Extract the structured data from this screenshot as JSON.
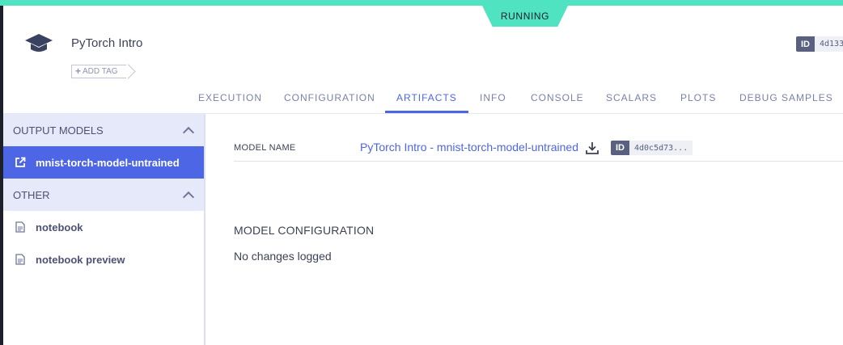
{
  "status": {
    "label": "RUNNING",
    "color": "#50e3c2"
  },
  "task": {
    "icon": "graduation-cap-icon",
    "title": "PyTorch Intro",
    "add_tag": "ADD TAG",
    "id_label": "ID",
    "id_value": "4d133"
  },
  "tabs": [
    {
      "label": "EXECUTION"
    },
    {
      "label": "CONFIGURATION"
    },
    {
      "label": "ARTIFACTS",
      "active": true
    },
    {
      "label": "INFO"
    },
    {
      "label": "CONSOLE"
    },
    {
      "label": "SCALARS"
    },
    {
      "label": "PLOTS"
    },
    {
      "label": "DEBUG SAMPLES"
    }
  ],
  "sidebar": {
    "sections": [
      {
        "title": "OUTPUT MODELS",
        "items": [
          {
            "label": "mnist-torch-model-untrained",
            "icon": "external-link-icon",
            "active": true
          }
        ]
      },
      {
        "title": "OTHER",
        "items": [
          {
            "label": "notebook",
            "icon": "document-icon"
          },
          {
            "label": "notebook preview",
            "icon": "document-icon"
          }
        ]
      }
    ]
  },
  "main": {
    "model_name_label": "MODEL NAME",
    "model_link": "PyTorch Intro - mnist-torch-model-untrained",
    "model_id_label": "ID",
    "model_id_value": "4d0c5d73...",
    "config_heading": "MODEL CONFIGURATION",
    "config_text": "No changes logged"
  },
  "colors": {
    "accent": "#4d66e6",
    "sidebar_section_bg": "#e6e9fa",
    "id_chip": "#5a6080"
  }
}
